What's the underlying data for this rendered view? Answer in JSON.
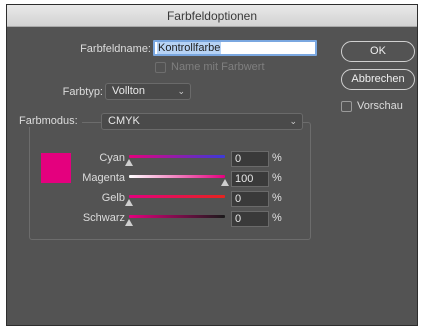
{
  "window": {
    "title": "Farbfeldoptionen"
  },
  "name": {
    "label": "Farbfeldname:",
    "value": "Kontrollfarbe"
  },
  "name_with_value": {
    "label": "Name mit Farbwert",
    "checked": false,
    "disabled": true
  },
  "color_type": {
    "label": "Farbtyp:",
    "value": "Vollton"
  },
  "color_mode": {
    "label": "Farbmodus:",
    "value": "CMYK"
  },
  "swatch_color": "#e4007e",
  "sliders": [
    {
      "label": "Cyan",
      "value": "0",
      "unit": "%",
      "fraction": 0.0
    },
    {
      "label": "Magenta",
      "value": "100",
      "unit": "%",
      "fraction": 1.0
    },
    {
      "label": "Gelb",
      "value": "0",
      "unit": "%",
      "fraction": 0.0
    },
    {
      "label": "Schwarz",
      "value": "0",
      "unit": "%",
      "fraction": 0.0
    }
  ],
  "buttons": {
    "ok": "OK",
    "cancel": "Abbrechen"
  },
  "preview": {
    "label": "Vorschau",
    "checked": false
  },
  "icons": {
    "dropdown": "chevron-down-icon",
    "thumb": "slider-thumb-icon"
  }
}
